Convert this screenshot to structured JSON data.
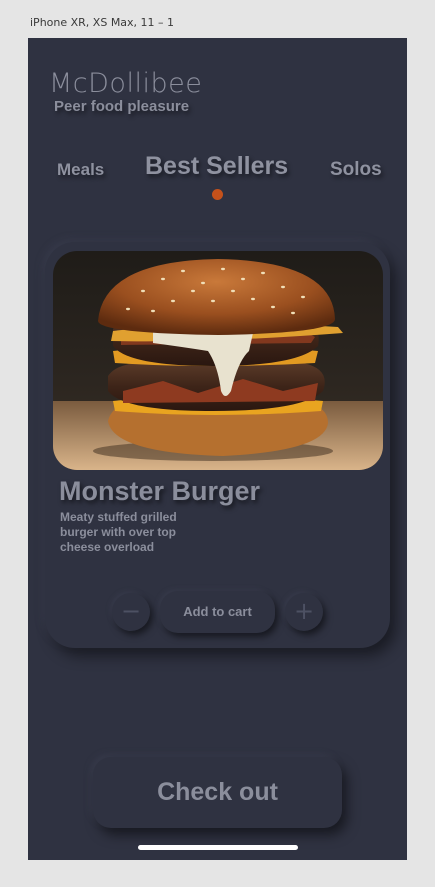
{
  "artboard": {
    "label": "iPhone XR, XS Max, 11 – 1"
  },
  "app": {
    "title": "McDollibee",
    "subtitle": "Peer food pleasure"
  },
  "tabs": [
    {
      "label": "Meals"
    },
    {
      "label": "Best Sellers",
      "active": true
    },
    {
      "label": "Solos"
    }
  ],
  "product": {
    "name": "Monster Burger",
    "description": "Meaty stuffed grilled burger with over top cheese overload",
    "image_icon": "burger-photo"
  },
  "cart": {
    "minus_label": "−",
    "add_label": "Add to cart",
    "plus_label": "+"
  },
  "checkout": {
    "label": "Check out"
  },
  "colors": {
    "background": "#2f3241",
    "text": "#8b8e9c",
    "accent": "#c4511b"
  }
}
